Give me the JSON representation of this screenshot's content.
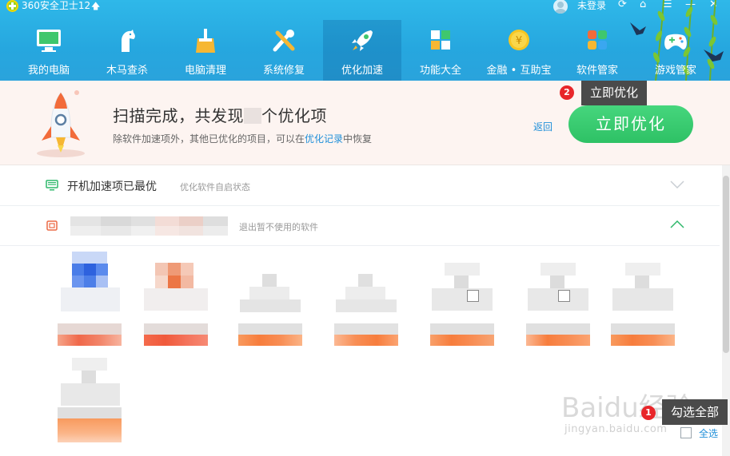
{
  "app": {
    "title": "360安全卫士12",
    "login_label": "未登录"
  },
  "nav": [
    {
      "label": "我的电脑",
      "icon": "monitor-icon"
    },
    {
      "label": "木马查杀",
      "icon": "horse-shield-icon"
    },
    {
      "label": "电脑清理",
      "icon": "broom-icon"
    },
    {
      "label": "系统修复",
      "icon": "wrench-icon"
    },
    {
      "label": "优化加速",
      "icon": "rocket-icon",
      "active": true
    },
    {
      "label": "功能大全",
      "icon": "grid-icon"
    },
    {
      "label": "金融 • 互助宝",
      "icon": "coin-icon"
    },
    {
      "label": "软件管家",
      "icon": "apps-icon"
    },
    {
      "label": "游戏管家",
      "icon": "gamepad-icon"
    }
  ],
  "banner": {
    "title_prefix": "扫描完成，共发现",
    "title_suffix": "个优化项",
    "subtitle_prefix": "除软件加速项外，其他已优化的项目，可以在",
    "subtitle_link": "优化记录",
    "subtitle_suffix": "中恢复",
    "back_label": "返回",
    "optimize_label": "立即优化"
  },
  "annotations": {
    "tip1_badge": "2",
    "tip1_label": "立即优化",
    "tip2_badge": "1",
    "tip2_label": "勾选全部"
  },
  "sections": [
    {
      "title": "开机加速项已最优",
      "desc": "优化软件自启状态",
      "expanded": false
    },
    {
      "title": "",
      "desc": "退出暂不使用的软件",
      "expanded": true
    }
  ],
  "footer": {
    "select_all_label": "全选"
  },
  "watermark": {
    "brand": "Baidu经验",
    "url": "jingyan.baidu.com"
  },
  "colors": {
    "header_blue": "#26a7df",
    "accent_green": "#2ec165",
    "link_blue": "#1f8fd9",
    "badge_red": "#e8262a"
  }
}
